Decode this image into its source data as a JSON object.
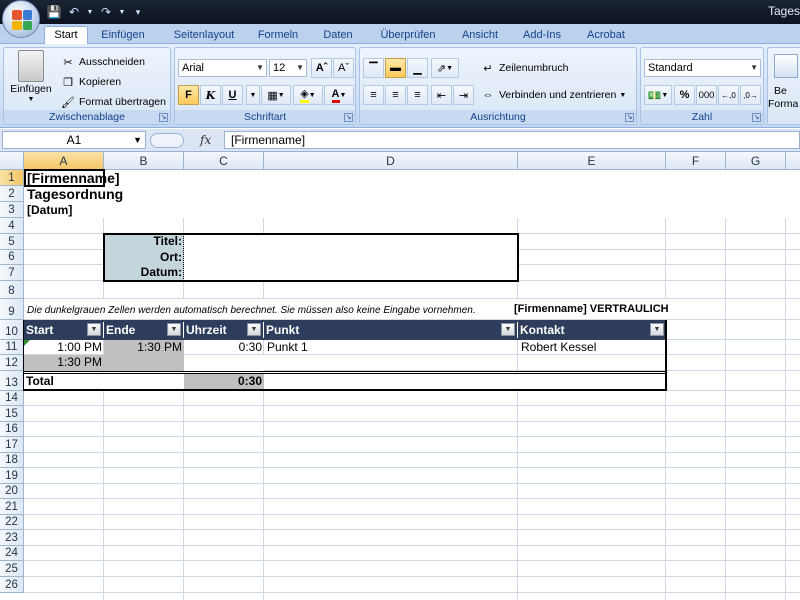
{
  "window": {
    "title": "Tages"
  },
  "ribbon": {
    "tabs": [
      "Start",
      "Einfügen",
      "Seitenlayout",
      "Formeln",
      "Daten",
      "Überprüfen",
      "Ansicht",
      "Add-Ins",
      "Acrobat"
    ],
    "clipboard": {
      "paste": "Einfügen",
      "cut": "Ausschneiden",
      "copy": "Kopieren",
      "format_painter": "Format übertragen",
      "label": "Zwischenablage"
    },
    "font": {
      "name": "Arial",
      "size": "12",
      "bold": "F",
      "italic": "K",
      "underline": "U",
      "label": "Schriftart"
    },
    "alignment": {
      "wrap": "Zeilenumbruch",
      "merge": "Verbinden und zentrieren",
      "label": "Ausrichtung"
    },
    "number": {
      "format": "Standard",
      "percent": "%",
      "thousands": "000",
      "label": "Zahl"
    },
    "cond_format": {
      "label1": "Be",
      "label2": "Forma"
    }
  },
  "formula_bar": {
    "name_box": "A1",
    "fx": "fx",
    "content": "[Firmenname]"
  },
  "columns": [
    "A",
    "B",
    "C",
    "D",
    "E",
    "F",
    "G"
  ],
  "rows": [
    "1",
    "2",
    "3",
    "4",
    "5",
    "6",
    "7",
    "8",
    "9",
    "10",
    "11",
    "12",
    "13",
    "14",
    "15",
    "16",
    "17",
    "18",
    "19",
    "20",
    "21",
    "22",
    "23",
    "24",
    "25",
    "26"
  ],
  "sheet": {
    "company": "[Firmenname]",
    "title": "Tagesordnung",
    "date": "[Datum]",
    "meta_labels": [
      "Titel:",
      "Ort:",
      "Datum:"
    ],
    "note": "Die dunkelgrauen Zellen werden automatisch berechnet. Sie müssen also keine Eingabe vornehmen.",
    "confidential": "[Firmenname] VERTRAULICH",
    "table_headers": [
      "Start",
      "Ende",
      "Uhrzeit",
      "Punkt",
      "Kontakt"
    ],
    "row11": {
      "start": "1:00 PM",
      "end": "1:30 PM",
      "time": "0:30",
      "item": "Punkt 1",
      "contact": "Robert Kessel"
    },
    "row12": {
      "start": "1:30 PM"
    },
    "total_label": "Total",
    "total_value": "0:30"
  }
}
